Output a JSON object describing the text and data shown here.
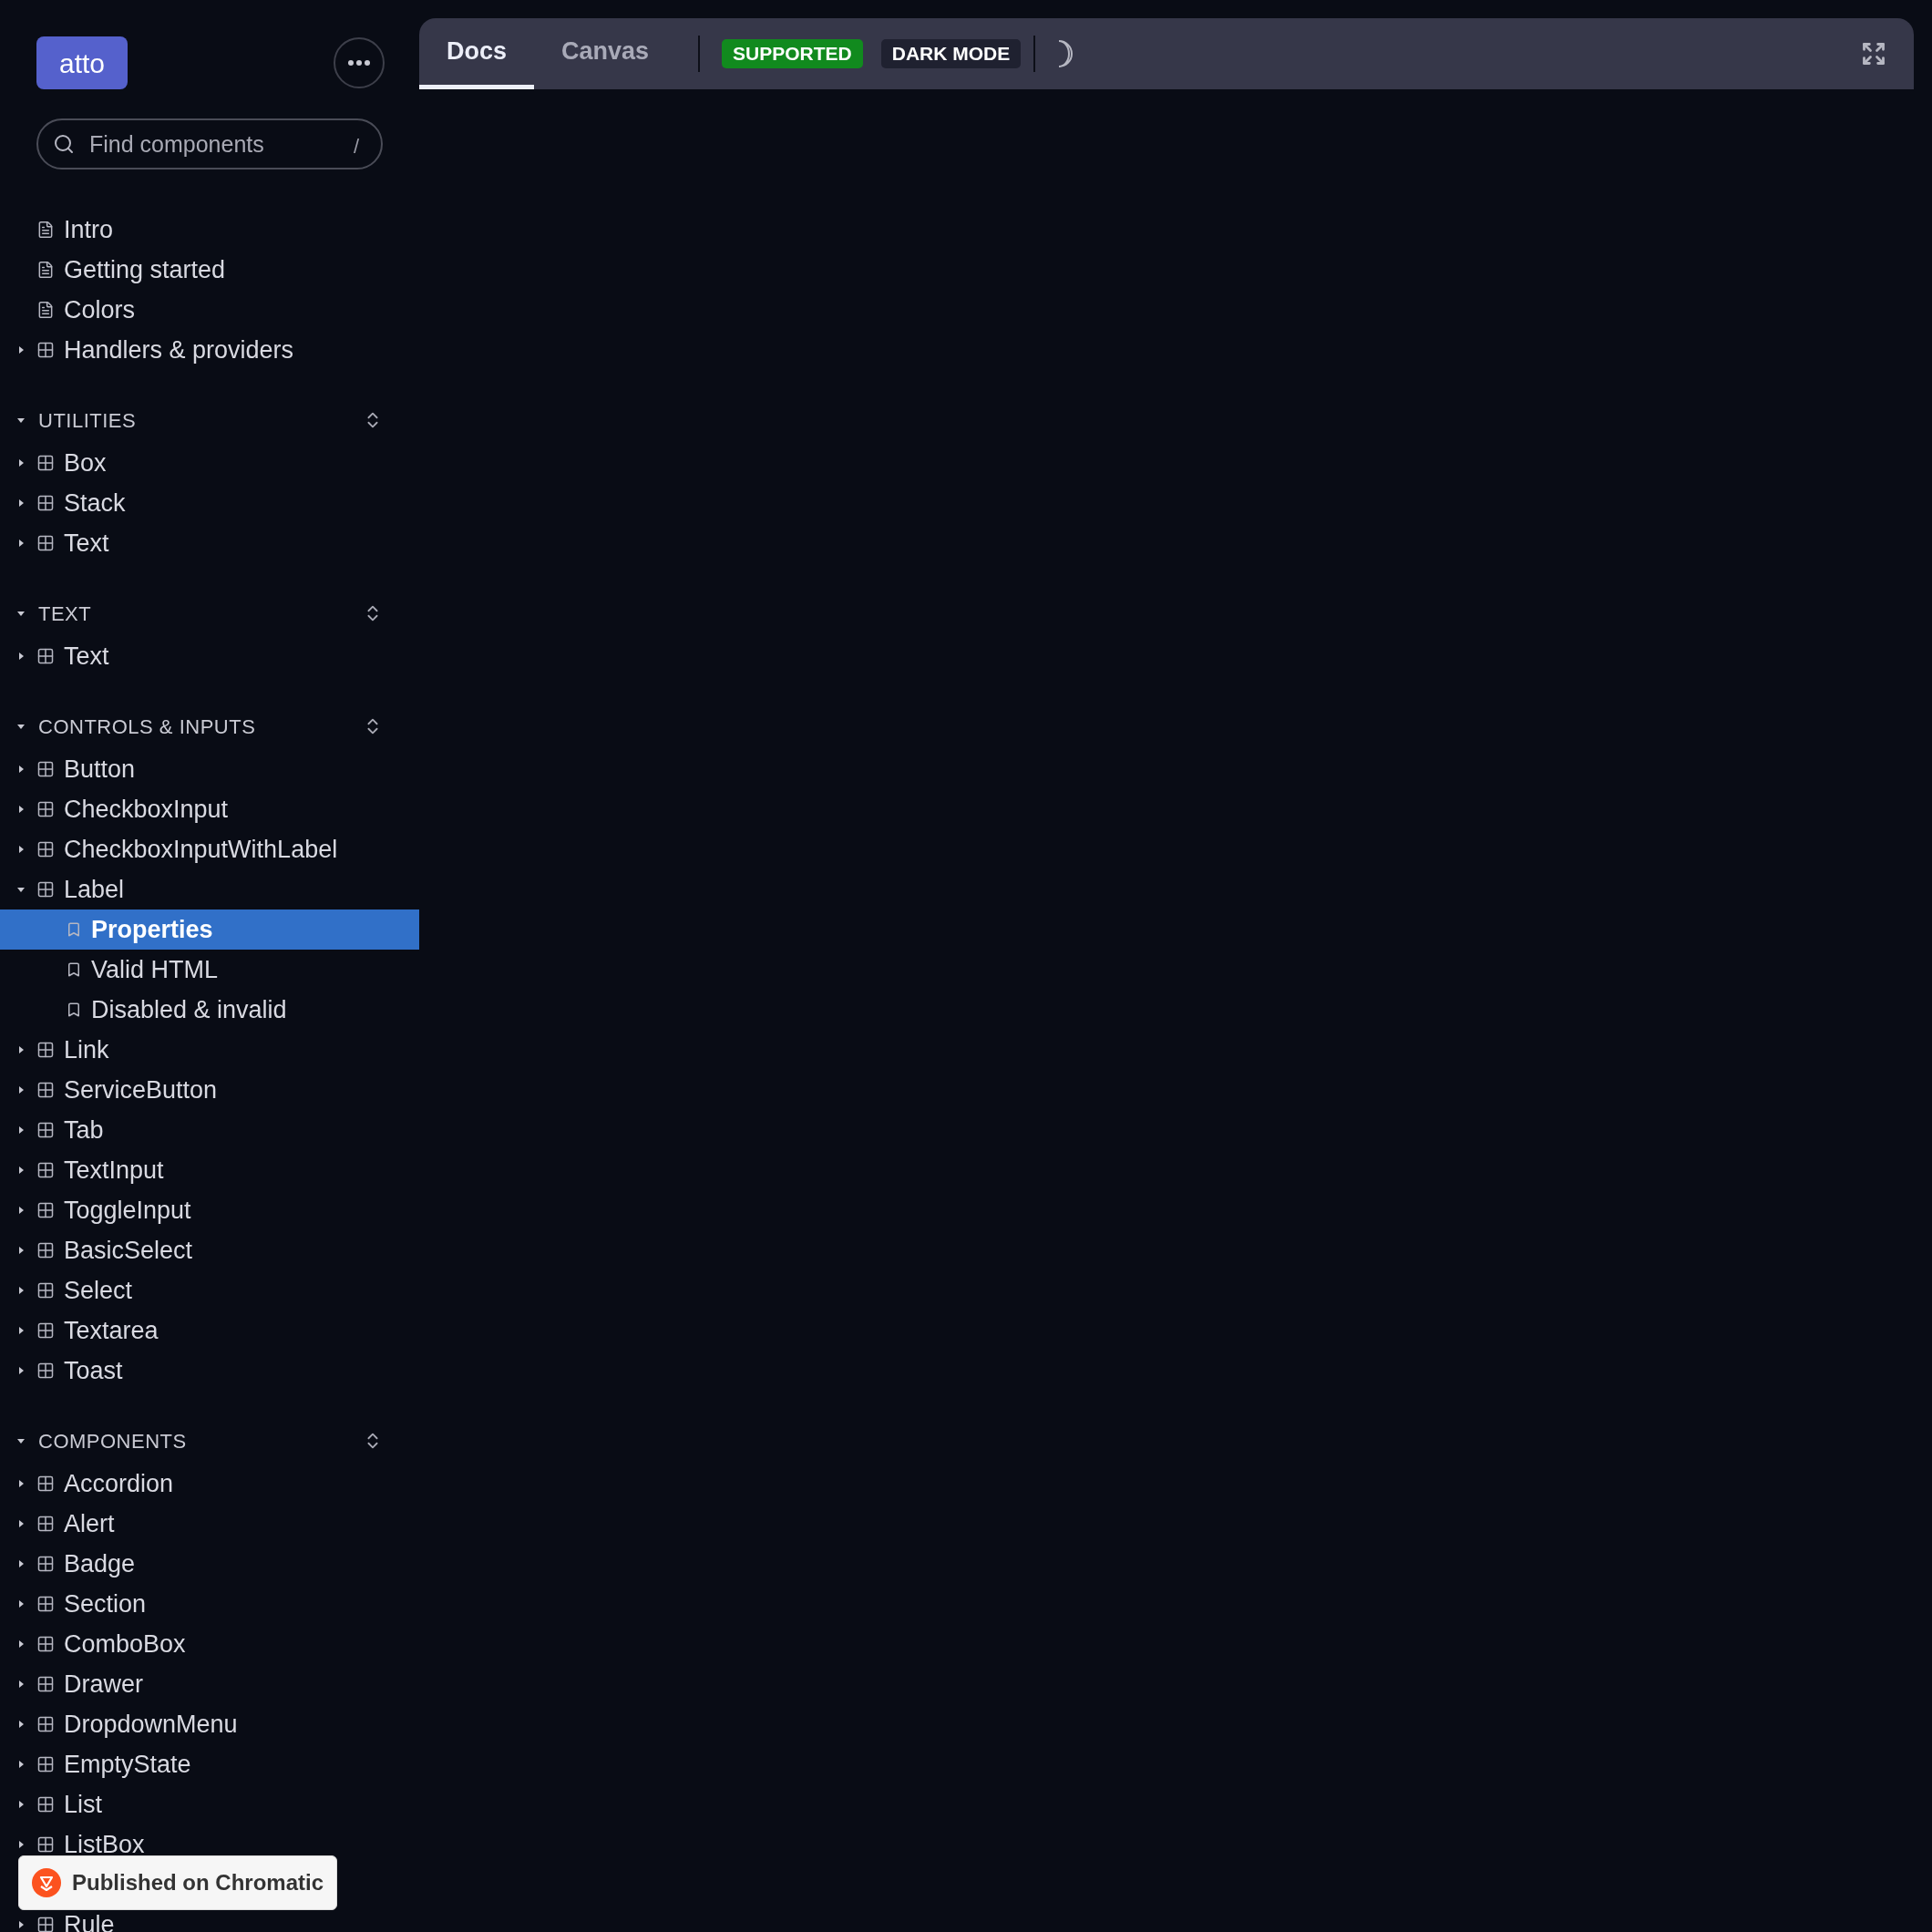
{
  "sidebar": {
    "logo": "atto",
    "search": {
      "placeholder": "Find components",
      "shortcut": "/"
    },
    "top_items": [
      {
        "label": "Intro",
        "kind": "doc"
      },
      {
        "label": "Getting started",
        "kind": "doc"
      },
      {
        "label": "Colors",
        "kind": "doc"
      },
      {
        "label": "Handlers & providers",
        "kind": "component",
        "expanded": false
      }
    ],
    "sections": [
      {
        "title": "UTILITIES",
        "expanded": true,
        "items": [
          {
            "label": "Box",
            "kind": "component",
            "expanded": false
          },
          {
            "label": "Stack",
            "kind": "component",
            "expanded": false
          },
          {
            "label": "Text",
            "kind": "component",
            "expanded": false
          }
        ]
      },
      {
        "title": "TEXT",
        "expanded": true,
        "items": [
          {
            "label": "Text",
            "kind": "component",
            "expanded": false
          }
        ]
      },
      {
        "title": "CONTROLS & INPUTS",
        "expanded": true,
        "items": [
          {
            "label": "Button",
            "kind": "component",
            "expanded": false
          },
          {
            "label": "CheckboxInput",
            "kind": "component",
            "expanded": false
          },
          {
            "label": "CheckboxInputWithLabel",
            "kind": "component",
            "expanded": false
          },
          {
            "label": "Label",
            "kind": "component",
            "expanded": true,
            "children": [
              {
                "label": "Properties",
                "kind": "story",
                "selected": true
              },
              {
                "label": "Valid HTML",
                "kind": "story",
                "selected": false
              },
              {
                "label": "Disabled & invalid",
                "kind": "story",
                "selected": false
              }
            ]
          },
          {
            "label": "Link",
            "kind": "component",
            "expanded": false
          },
          {
            "label": "ServiceButton",
            "kind": "component",
            "expanded": false
          },
          {
            "label": "Tab",
            "kind": "component",
            "expanded": false
          },
          {
            "label": "TextInput",
            "kind": "component",
            "expanded": false
          },
          {
            "label": "ToggleInput",
            "kind": "component",
            "expanded": false
          },
          {
            "label": "BasicSelect",
            "kind": "component",
            "expanded": false
          },
          {
            "label": "Select",
            "kind": "component",
            "expanded": false
          },
          {
            "label": "Textarea",
            "kind": "component",
            "expanded": false
          },
          {
            "label": "Toast",
            "kind": "component",
            "expanded": false
          }
        ]
      },
      {
        "title": "COMPONENTS",
        "expanded": true,
        "items": [
          {
            "label": "Accordion",
            "kind": "component",
            "expanded": false
          },
          {
            "label": "Alert",
            "kind": "component",
            "expanded": false
          },
          {
            "label": "Badge",
            "kind": "component",
            "expanded": false
          },
          {
            "label": "Section",
            "kind": "component",
            "expanded": false
          },
          {
            "label": "ComboBox",
            "kind": "component",
            "expanded": false
          },
          {
            "label": "Drawer",
            "kind": "component",
            "expanded": false
          },
          {
            "label": "DropdownMenu",
            "kind": "component",
            "expanded": false
          },
          {
            "label": "EmptyState",
            "kind": "component",
            "expanded": false
          },
          {
            "label": "List",
            "kind": "component",
            "expanded": false
          },
          {
            "label": "ListBox",
            "kind": "component",
            "expanded": false
          },
          {
            "kind": "hidden"
          },
          {
            "label": "Rule",
            "kind": "component",
            "expanded": false
          }
        ]
      }
    ]
  },
  "toolbar": {
    "tabs": [
      {
        "label": "Docs",
        "selected": true
      },
      {
        "label": "Canvas",
        "selected": false
      }
    ],
    "badges": [
      {
        "label": "SUPPORTED",
        "color": "#118a1e"
      },
      {
        "label": "DARK MODE",
        "color": "#1f2130"
      }
    ]
  },
  "chromatic_badge": "Published on Chromatic"
}
